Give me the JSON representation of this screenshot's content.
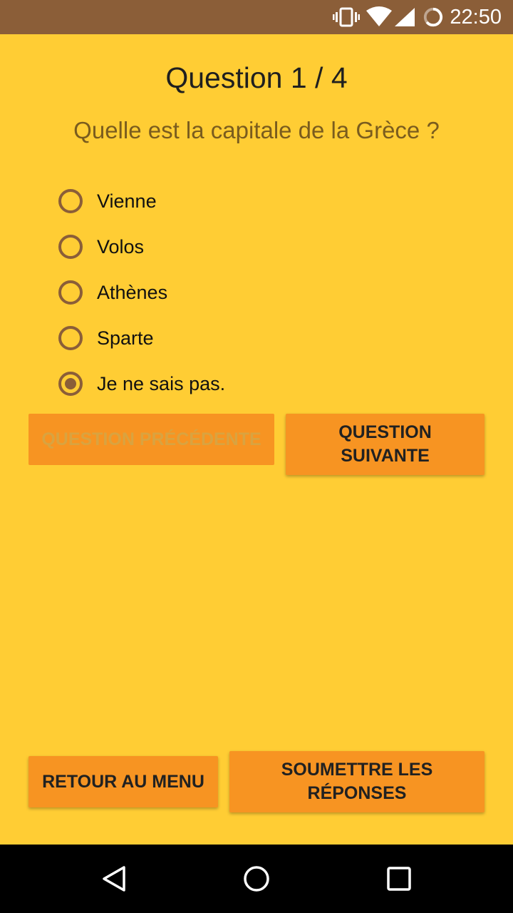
{
  "status_bar": {
    "time": "22:50",
    "icons": [
      "vibrate-icon",
      "wifi-icon",
      "signal-icon",
      "battery-icon"
    ]
  },
  "quiz": {
    "title": "Question 1 / 4",
    "question": "Quelle est la capitale de la Grèce ?",
    "options": [
      {
        "label": "Vienne",
        "selected": false
      },
      {
        "label": "Volos",
        "selected": false
      },
      {
        "label": "Athènes",
        "selected": false
      },
      {
        "label": "Sparte",
        "selected": false
      },
      {
        "label": "Je ne sais pas.",
        "selected": true
      }
    ]
  },
  "buttons": {
    "previous": {
      "label": "QUESTION PRÉCÉDENTE",
      "enabled": false
    },
    "next": {
      "label": "QUESTION SUIVANTE",
      "enabled": true
    },
    "menu": {
      "label": "RETOUR AU MENU",
      "enabled": true
    },
    "submit": {
      "label": "SOUMETTRE LES RÉPONSES",
      "enabled": true
    }
  },
  "nav_bar": {
    "icons": [
      "back-icon",
      "home-icon",
      "recents-icon"
    ]
  },
  "colors": {
    "background": "#ffcd34",
    "status_bar": "#8b5e38",
    "button": "#f79422",
    "accent": "#8b5e38",
    "question_text": "#7a5c1e"
  }
}
